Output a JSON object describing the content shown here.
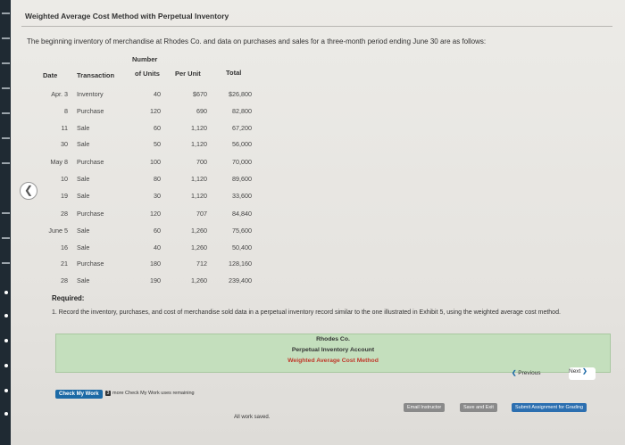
{
  "title": "Weighted Average Cost Method with Perpetual Inventory",
  "intro": "The beginning inventory of merchandise at Rhodes Co. and data on purchases and sales for a three-month period ending June 30 are as follows:",
  "table": {
    "headers": {
      "date": "Date",
      "transaction": "Transaction",
      "number_top": "Number",
      "units": "of Units",
      "per_unit": "Per Unit",
      "total": "Total"
    },
    "rows": [
      {
        "date": "Apr. 3",
        "trans": "Inventory",
        "units": "40",
        "per": "$670",
        "total": "$26,800"
      },
      {
        "date": "8",
        "trans": "Purchase",
        "units": "120",
        "per": "690",
        "total": "82,800"
      },
      {
        "date": "11",
        "trans": "Sale",
        "units": "60",
        "per": "1,120",
        "total": "67,200"
      },
      {
        "date": "30",
        "trans": "Sale",
        "units": "50",
        "per": "1,120",
        "total": "56,000"
      },
      {
        "date": "May 8",
        "trans": "Purchase",
        "units": "100",
        "per": "700",
        "total": "70,000"
      },
      {
        "date": "10",
        "trans": "Sale",
        "units": "80",
        "per": "1,120",
        "total": "89,600"
      },
      {
        "date": "19",
        "trans": "Sale",
        "units": "30",
        "per": "1,120",
        "total": "33,600"
      },
      {
        "date": "28",
        "trans": "Purchase",
        "units": "120",
        "per": "707",
        "total": "84,840"
      },
      {
        "date": "June 5",
        "trans": "Sale",
        "units": "60",
        "per": "1,260",
        "total": "75,600"
      },
      {
        "date": "16",
        "trans": "Sale",
        "units": "40",
        "per": "1,260",
        "total": "50,400"
      },
      {
        "date": "21",
        "trans": "Purchase",
        "units": "180",
        "per": "712",
        "total": "128,160"
      },
      {
        "date": "28",
        "trans": "Sale",
        "units": "190",
        "per": "1,260",
        "total": "239,400"
      }
    ]
  },
  "required": {
    "label": "Required:",
    "instruction": "1. Record the inventory, purchases, and cost of merchandise sold data in a perpetual inventory record similar to the one illustrated in Exhibit 5, using the weighted average cost method."
  },
  "answer_panel": {
    "company": "Rhodes Co.",
    "heading": "Perpetual Inventory Account",
    "method": "Weighted Average Cost Method"
  },
  "nav": {
    "previous": "Previous",
    "next": "Next"
  },
  "check": {
    "button": "Check My Work",
    "remaining_count": "3",
    "remaining_text": "more Check My Work uses remaining"
  },
  "footer": {
    "status": "All work saved.",
    "email": "Email Instructor",
    "save_exit": "Save and Exit",
    "submit": "Submit Assignment for Grading"
  },
  "colors": {
    "check_button": "#1c6aa6",
    "answer_panel": "#c4dfbd",
    "email_button": "#8a8a8a",
    "save_button": "#8a8a8a",
    "submit_button": "#2c6fb0"
  },
  "icons": {
    "back": "chevron-left-icon",
    "previous": "chevron-left-icon",
    "next": "chevron-right-icon"
  }
}
